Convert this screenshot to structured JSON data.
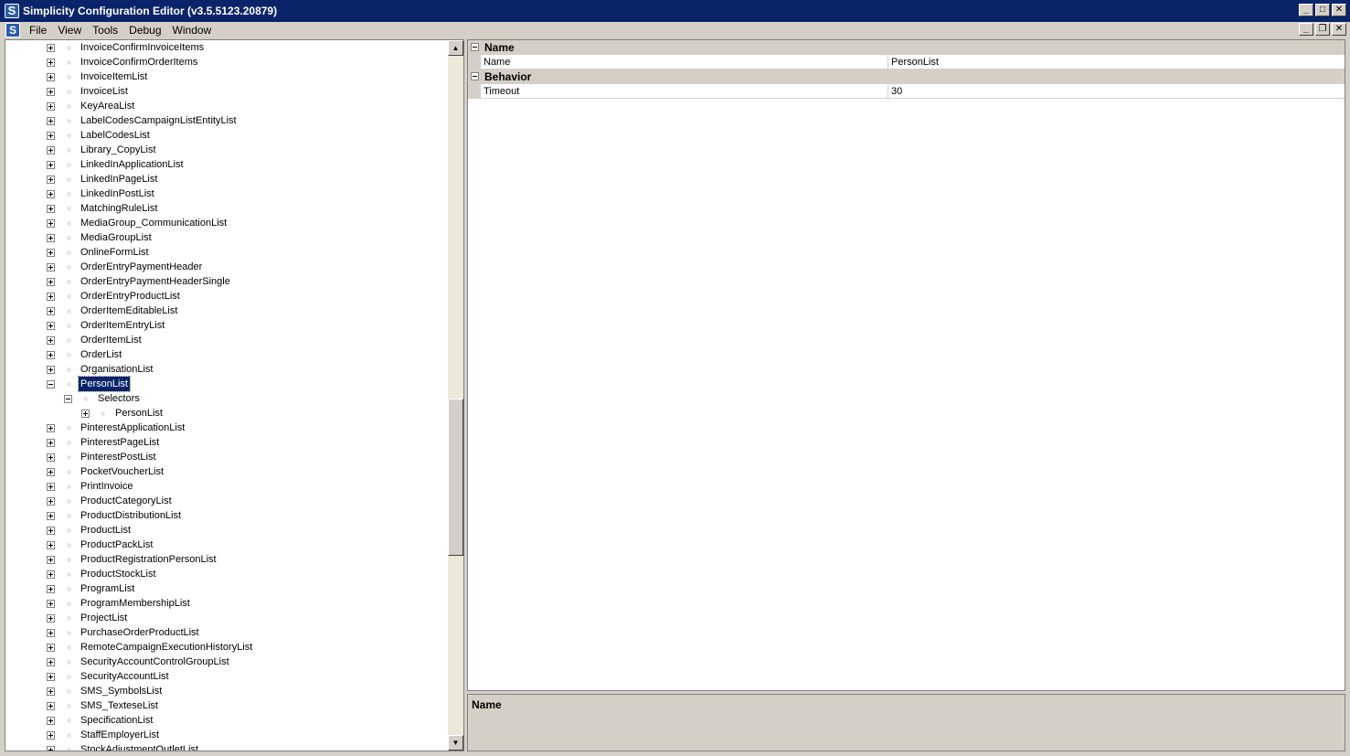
{
  "window": {
    "title": "Simplicity Configuration Editor (v3.5.5123.20879)",
    "icon": "S"
  },
  "menu": [
    "File",
    "View",
    "Tools",
    "Debug",
    "Window"
  ],
  "tree": [
    {
      "label": "InvoiceConfirmInvoiceItems",
      "level": 0,
      "exp": "plus"
    },
    {
      "label": "InvoiceConfirmOrderItems",
      "level": 0,
      "exp": "plus"
    },
    {
      "label": "InvoiceItemList",
      "level": 0,
      "exp": "plus"
    },
    {
      "label": "InvoiceList",
      "level": 0,
      "exp": "plus"
    },
    {
      "label": "KeyAreaList",
      "level": 0,
      "exp": "plus"
    },
    {
      "label": "LabelCodesCampaignListEntityList",
      "level": 0,
      "exp": "plus"
    },
    {
      "label": "LabelCodesList",
      "level": 0,
      "exp": "plus"
    },
    {
      "label": "Library_CopyList",
      "level": 0,
      "exp": "plus"
    },
    {
      "label": "LinkedInApplicationList",
      "level": 0,
      "exp": "plus"
    },
    {
      "label": "LinkedInPageList",
      "level": 0,
      "exp": "plus"
    },
    {
      "label": "LinkedInPostList",
      "level": 0,
      "exp": "plus"
    },
    {
      "label": "MatchingRuleList",
      "level": 0,
      "exp": "plus"
    },
    {
      "label": "MediaGroup_CommunicationList",
      "level": 0,
      "exp": "plus"
    },
    {
      "label": "MediaGroupList",
      "level": 0,
      "exp": "plus"
    },
    {
      "label": "OnlineFormList",
      "level": 0,
      "exp": "plus"
    },
    {
      "label": "OrderEntryPaymentHeader",
      "level": 0,
      "exp": "plus"
    },
    {
      "label": "OrderEntryPaymentHeaderSingle",
      "level": 0,
      "exp": "plus"
    },
    {
      "label": "OrderEntryProductList",
      "level": 0,
      "exp": "plus"
    },
    {
      "label": "OrderItemEditableList",
      "level": 0,
      "exp": "plus"
    },
    {
      "label": "OrderItemEntryList",
      "level": 0,
      "exp": "plus"
    },
    {
      "label": "OrderItemList",
      "level": 0,
      "exp": "plus"
    },
    {
      "label": "OrderList",
      "level": 0,
      "exp": "plus"
    },
    {
      "label": "OrganisationList",
      "level": 0,
      "exp": "plus"
    },
    {
      "label": "PersonList",
      "level": 0,
      "exp": "minus",
      "selected": true
    },
    {
      "label": "Selectors",
      "level": 1,
      "exp": "minus"
    },
    {
      "label": "PersonList",
      "level": 2,
      "exp": "plus"
    },
    {
      "label": "PinterestApplicationList",
      "level": 0,
      "exp": "plus"
    },
    {
      "label": "PinterestPageList",
      "level": 0,
      "exp": "plus"
    },
    {
      "label": "PinterestPostList",
      "level": 0,
      "exp": "plus"
    },
    {
      "label": "PocketVoucherList",
      "level": 0,
      "exp": "plus"
    },
    {
      "label": "PrintInvoice",
      "level": 0,
      "exp": "plus"
    },
    {
      "label": "ProductCategoryList",
      "level": 0,
      "exp": "plus"
    },
    {
      "label": "ProductDistributionList",
      "level": 0,
      "exp": "plus"
    },
    {
      "label": "ProductList",
      "level": 0,
      "exp": "plus"
    },
    {
      "label": "ProductPackList",
      "level": 0,
      "exp": "plus"
    },
    {
      "label": "ProductRegistrationPersonList",
      "level": 0,
      "exp": "plus"
    },
    {
      "label": "ProductStockList",
      "level": 0,
      "exp": "plus"
    },
    {
      "label": "ProgramList",
      "level": 0,
      "exp": "plus"
    },
    {
      "label": "ProgramMembershipList",
      "level": 0,
      "exp": "plus"
    },
    {
      "label": "ProjectList",
      "level": 0,
      "exp": "plus"
    },
    {
      "label": "PurchaseOrderProductList",
      "level": 0,
      "exp": "plus"
    },
    {
      "label": "RemoteCampaignExecutionHistoryList",
      "level": 0,
      "exp": "plus"
    },
    {
      "label": "SecurityAccountControlGroupList",
      "level": 0,
      "exp": "plus"
    },
    {
      "label": "SecurityAccountList",
      "level": 0,
      "exp": "plus"
    },
    {
      "label": "SMS_SymbolsList",
      "level": 0,
      "exp": "plus"
    },
    {
      "label": "SMS_TexteseList",
      "level": 0,
      "exp": "plus"
    },
    {
      "label": "SpecificationList",
      "level": 0,
      "exp": "plus"
    },
    {
      "label": "StaffEmployerList",
      "level": 0,
      "exp": "plus"
    },
    {
      "label": "StockAdjustmentOutletList",
      "level": 0,
      "exp": "plus"
    }
  ],
  "properties": {
    "categories": [
      {
        "name": "Name",
        "rows": [
          {
            "name": "Name",
            "value": "PersonList"
          }
        ]
      },
      {
        "name": "Behavior",
        "rows": [
          {
            "name": "Timeout",
            "value": "30"
          }
        ]
      }
    ]
  },
  "description": {
    "title": "Name"
  }
}
